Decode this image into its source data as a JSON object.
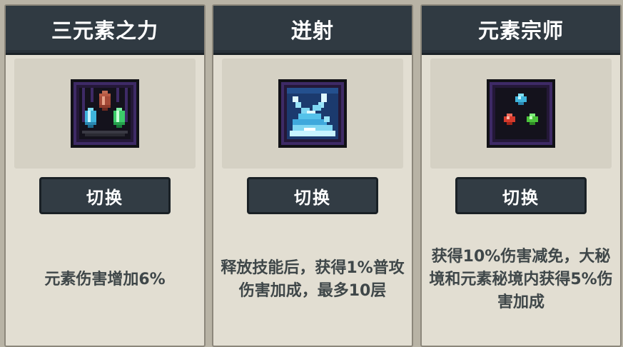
{
  "cards": [
    {
      "title": "三元素之力",
      "icon": "tri-element-crystals-icon",
      "button_label": "切换",
      "description": "元素伤害增加6%"
    },
    {
      "title": "迸射",
      "icon": "ice-burst-icon",
      "button_label": "切换",
      "description": "释放技能后，获得1%普攻伤害加成，最多10层"
    },
    {
      "title": "元素宗师",
      "icon": "element-master-orbs-icon",
      "button_label": "切换",
      "description": "获得10%伤害减免，大秘境和元素秘境内获得5%伤害加成"
    }
  ],
  "colors": {
    "background": "#b8b3a5",
    "card": "#e2ded2",
    "title_bar": "#303a42",
    "button": "#323c44",
    "description_text": "#3f4749",
    "icon_frame_purple": "#3e2a66"
  }
}
